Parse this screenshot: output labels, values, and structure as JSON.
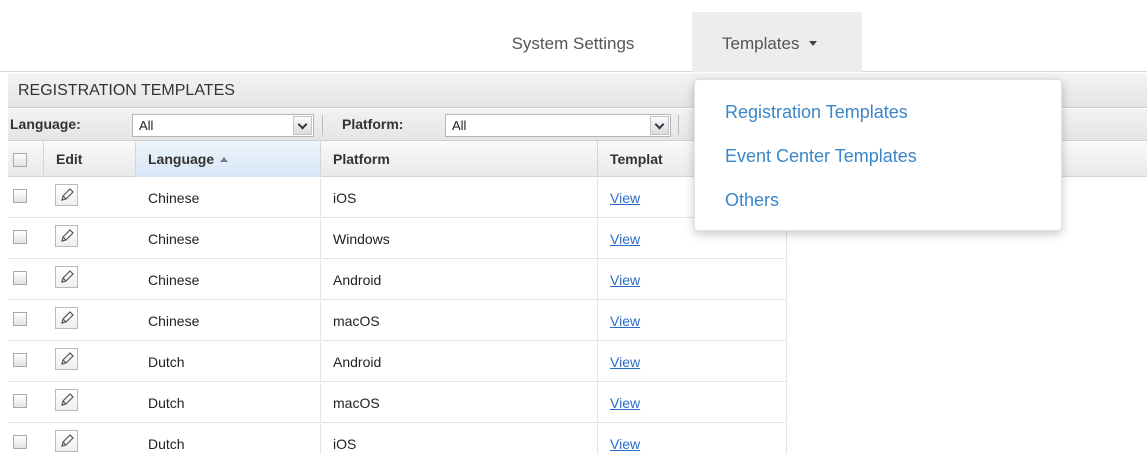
{
  "nav": {
    "system_settings": "System Settings",
    "templates": "Templates"
  },
  "panel": {
    "title": "REGISTRATION TEMPLATES"
  },
  "filters": {
    "language_label": "Language:",
    "language_value": "All",
    "platform_label": "Platform:",
    "platform_value": "All"
  },
  "table": {
    "columns": [
      "Edit",
      "Language",
      "Platform",
      "Templat"
    ],
    "sorted_column": "Language",
    "rows": [
      {
        "language": "Chinese",
        "platform": "iOS",
        "template": "View"
      },
      {
        "language": "Chinese",
        "platform": "Windows",
        "template": "View"
      },
      {
        "language": "Chinese",
        "platform": "Android",
        "template": "View"
      },
      {
        "language": "Chinese",
        "platform": "macOS",
        "template": "View"
      },
      {
        "language": "Dutch",
        "platform": "Android",
        "template": "View"
      },
      {
        "language": "Dutch",
        "platform": "macOS",
        "template": "View"
      },
      {
        "language": "Dutch",
        "platform": "iOS",
        "template": "View"
      }
    ]
  },
  "dropdown": {
    "items": [
      "Registration Templates",
      "Event Center Templates",
      "Others"
    ]
  },
  "icons": {
    "edit": "pencil-icon",
    "sort": "sort-ascending-icon",
    "select": "chevron-down-icon",
    "nav_caret": "caret-down-icon"
  },
  "colors": {
    "link": "#2a6cc4",
    "menu_link": "#3a86c8",
    "active_nav_bg": "#ededed"
  }
}
